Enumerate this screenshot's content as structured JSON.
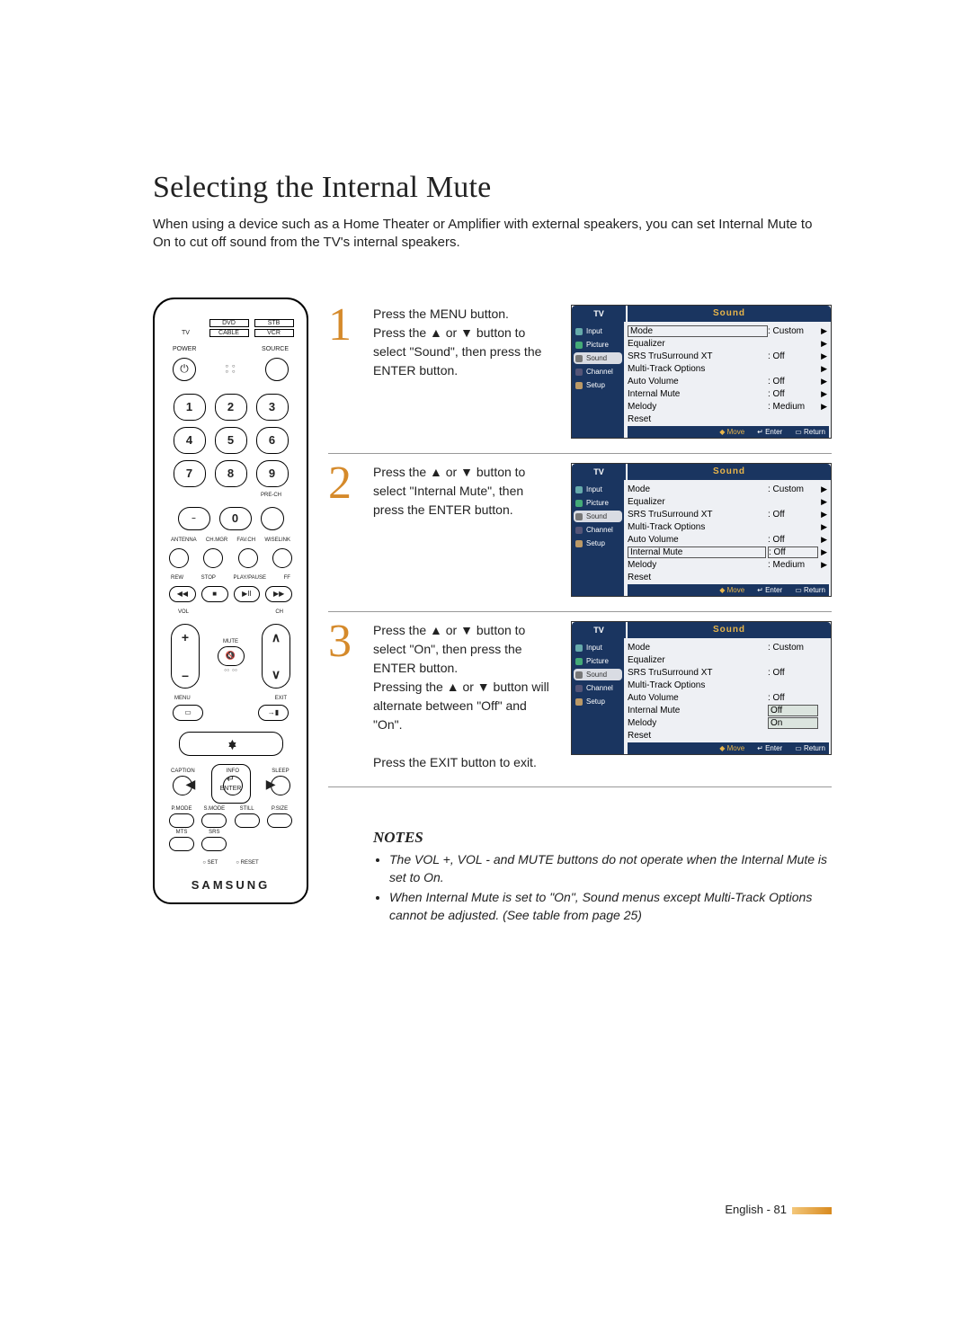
{
  "title": "Selecting the Internal Mute",
  "intro": "When using a device such as a Home Theater or Amplifier with external speakers, you can set Internal Mute to On to cut off sound from the TV's internal speakers.",
  "remote": {
    "devices": {
      "tv": "TV",
      "dvd": "DVD",
      "stb": "STB",
      "cable": "CABLE",
      "vcr": "VCR"
    },
    "power": "POWER",
    "source": "SOURCE",
    "numbers": [
      "1",
      "2",
      "3",
      "4",
      "5",
      "6",
      "7",
      "8",
      "9"
    ],
    "dash": "–",
    "zero": "0",
    "prech": "PRE-CH",
    "row_small": [
      "ANTENNA",
      "CH.MGR",
      "FAV.CH",
      "WISELINK"
    ],
    "transport": [
      "REW",
      "STOP",
      "PLAY/PAUSE",
      "FF"
    ],
    "transport_sym": [
      "◀◀",
      "■",
      "▶II",
      "▶▶"
    ],
    "vol": "VOL",
    "ch": "CH",
    "mute": "MUTE",
    "menu": "MENU",
    "exit": "EXIT",
    "enter": "ENTER",
    "midrow": [
      "CAPTION",
      "INFO",
      "SLEEP"
    ],
    "botrow": [
      "P.MODE",
      "S.MODE",
      "STILL",
      "P.SIZE"
    ],
    "botrow2": [
      "MTS",
      "SRS"
    ],
    "set": "SET",
    "reset": "RESET",
    "brand": "SAMSUNG"
  },
  "steps": [
    {
      "num": "1",
      "text": "Press the MENU button.\nPress the ▲ or ▼ button to select \"Sound\", then press the ENTER button."
    },
    {
      "num": "2",
      "text": "Press the ▲ or ▼ button to select \"Internal Mute\", then press the ENTER button."
    },
    {
      "num": "3",
      "text": "Press the ▲ or ▼ button to select \"On\", then press the ENTER button.\nPressing the ▲ or ▼ button will alternate between \"Off\" and \"On\".\n\nPress the EXIT button to exit."
    }
  ],
  "osd": {
    "tv": "TV",
    "title": "Sound",
    "nav": [
      "Input",
      "Picture",
      "Sound",
      "Channel",
      "Setup"
    ],
    "rows": {
      "mode": {
        "lab": "Mode",
        "val": ": Custom"
      },
      "equalizer": {
        "lab": "Equalizer",
        "val": ""
      },
      "srs": {
        "lab": "SRS TruSurround XT",
        "val": ": Off"
      },
      "multi": {
        "lab": "Multi-Track Options",
        "val": ""
      },
      "autovol": {
        "lab": "Auto Volume",
        "val": ": Off"
      },
      "internal": {
        "lab": "Internal Mute",
        "val": ": Off"
      },
      "melody": {
        "lab": "Melody",
        "val": ": Medium"
      },
      "reset": {
        "lab": "Reset",
        "val": ""
      },
      "off_opt": "Off",
      "on_opt": "On"
    },
    "footer": {
      "move": "Move",
      "enter": "Enter",
      "return": "Return"
    }
  },
  "notes_title": "NOTES",
  "notes": [
    "The VOL +, VOL - and MUTE buttons do not operate when the Internal Mute is set to On.",
    "When Internal Mute is set to \"On\", Sound menus except Multi-Track Options cannot be adjusted. (See table from page 25)"
  ],
  "footer": "English - 81"
}
